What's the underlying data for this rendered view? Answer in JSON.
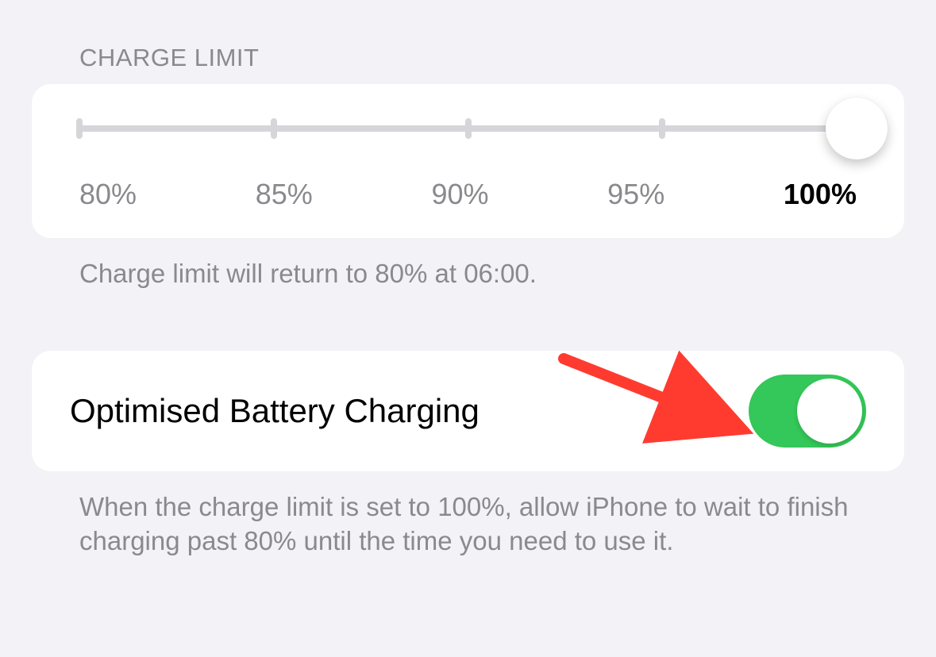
{
  "section": {
    "header": "CHARGE LIMIT",
    "slider": {
      "ticks": [
        "80%",
        "85%",
        "90%",
        "95%",
        "100%"
      ],
      "selected_index": 4
    },
    "footer": "Charge limit will return to 80% at 06:00."
  },
  "optimised": {
    "label": "Optimised Battery Charging",
    "enabled": true,
    "footer": "When the charge limit is set to 100%, allow iPhone to wait to finish charging past 80% until the time you need to use it."
  },
  "colors": {
    "toggle_on": "#34c759",
    "annotation_arrow": "#ff3b30"
  }
}
